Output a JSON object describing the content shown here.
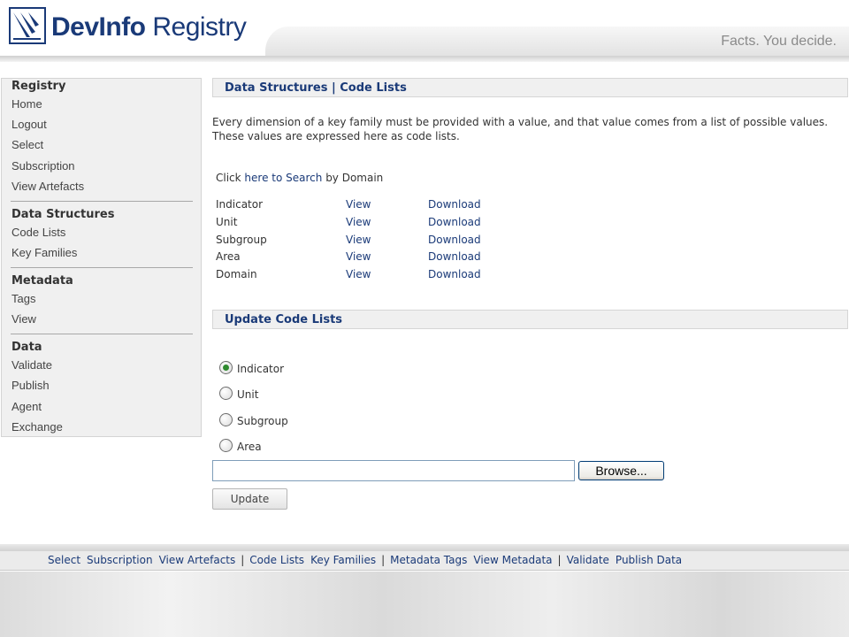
{
  "header": {
    "logo_bold": "DevInfo",
    "logo_regular": " Registry",
    "tagline": "Facts. You decide."
  },
  "colors": {
    "brand_blue": "#1a3a78",
    "link_blue": "#1a3a78",
    "radio_checked": "#2f8a2f"
  },
  "sidebar": {
    "sections": [
      {
        "heading": "Registry",
        "items": [
          "Home",
          "Logout",
          "Select",
          "Subscription",
          "View Artefacts"
        ]
      },
      {
        "heading": "Data Structures",
        "items": [
          "Code Lists",
          "Key Families"
        ]
      },
      {
        "heading": "Metadata",
        "items": [
          "Tags",
          "View"
        ]
      },
      {
        "heading": "Data",
        "items": [
          "Validate",
          "Publish",
          "Agent",
          "Exchange"
        ]
      }
    ]
  },
  "main": {
    "section1_title": "Data Structures | Code Lists",
    "description": "Every dimension of a key family must be provided with a value, and that value comes from a list of possible values. These values are expressed here as code lists.",
    "search_prefix": "Click ",
    "search_link": "here to Search",
    "search_suffix": " by Domain",
    "code_lists": [
      {
        "name": "Indicator",
        "view": "View",
        "download": "Download"
      },
      {
        "name": "Unit",
        "view": "View",
        "download": "Download"
      },
      {
        "name": "Subgroup",
        "view": "View",
        "download": "Download"
      },
      {
        "name": "Area",
        "view": "View",
        "download": "Download"
      },
      {
        "name": "Domain",
        "view": "View",
        "download": "Download"
      }
    ],
    "section2_title": "Update Code Lists",
    "radio_options": [
      {
        "label": "Indicator",
        "checked": true
      },
      {
        "label": "Unit",
        "checked": false
      },
      {
        "label": "Subgroup",
        "checked": false
      },
      {
        "label": "Area",
        "checked": false
      }
    ],
    "file_value": "",
    "browse_label": "Browse...",
    "update_label": "Update"
  },
  "footer": {
    "groups": [
      [
        "Select",
        "Subscription",
        "View Artefacts"
      ],
      [
        "Code Lists",
        "Key Families"
      ],
      [
        "Metadata Tags",
        "View Metadata"
      ],
      [
        "Validate",
        "Publish Data"
      ]
    ],
    "separator": "|"
  }
}
